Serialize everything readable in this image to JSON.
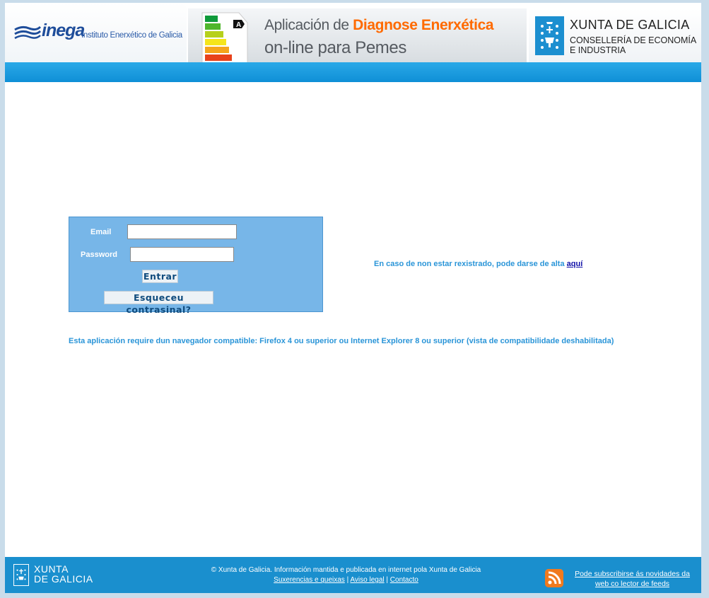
{
  "header": {
    "inega_name": "inega",
    "inega_subtitle": "Instituto Enerxético de Galicia",
    "app_title_prefix": "Aplicación de ",
    "app_title_highlight": "Diagnose Enerxética",
    "app_title_line2": "on-line para Pemes",
    "energy_label_letter": "A",
    "xunta_title": "XUNTA DE GALICIA",
    "xunta_sub_line1": "CONSELLERÍA DE ECONOMÍA",
    "xunta_sub_line2": "E INDUSTRIA"
  },
  "login": {
    "email_label": "Email",
    "email_value": "",
    "password_label": "Password",
    "password_value": "",
    "submit_label": "Entrar",
    "forgot_label": "Esqueceu contrasinal?"
  },
  "register": {
    "text": "En caso de non estar rexistrado, pode darse de alta ",
    "link": "aquí"
  },
  "compat_notice": "Esta aplicación require dun navegador compatible: Firefox 4 ou superior ou Internet Explorer 8 ou superior (vista de compatibilidade deshabilitada)",
  "footer": {
    "logo_line1": "XUNTA",
    "logo_line2": "DE GALICIA",
    "copyright": "© Xunta de Galicia. Información mantida e publicada en internet pola Xunta de Galicia",
    "links": [
      "Suxerencias e queixas",
      "Aviso legal",
      "Contacto"
    ],
    "separator": "|",
    "rss_text": "Pode subscribirse ás novidades da web co lector de feeds"
  },
  "colors": {
    "accent_orange": "#ff6a00",
    "header_blue": "#1a8fce",
    "login_panel": "#77b6e8",
    "link_blue": "#2a95d8"
  }
}
